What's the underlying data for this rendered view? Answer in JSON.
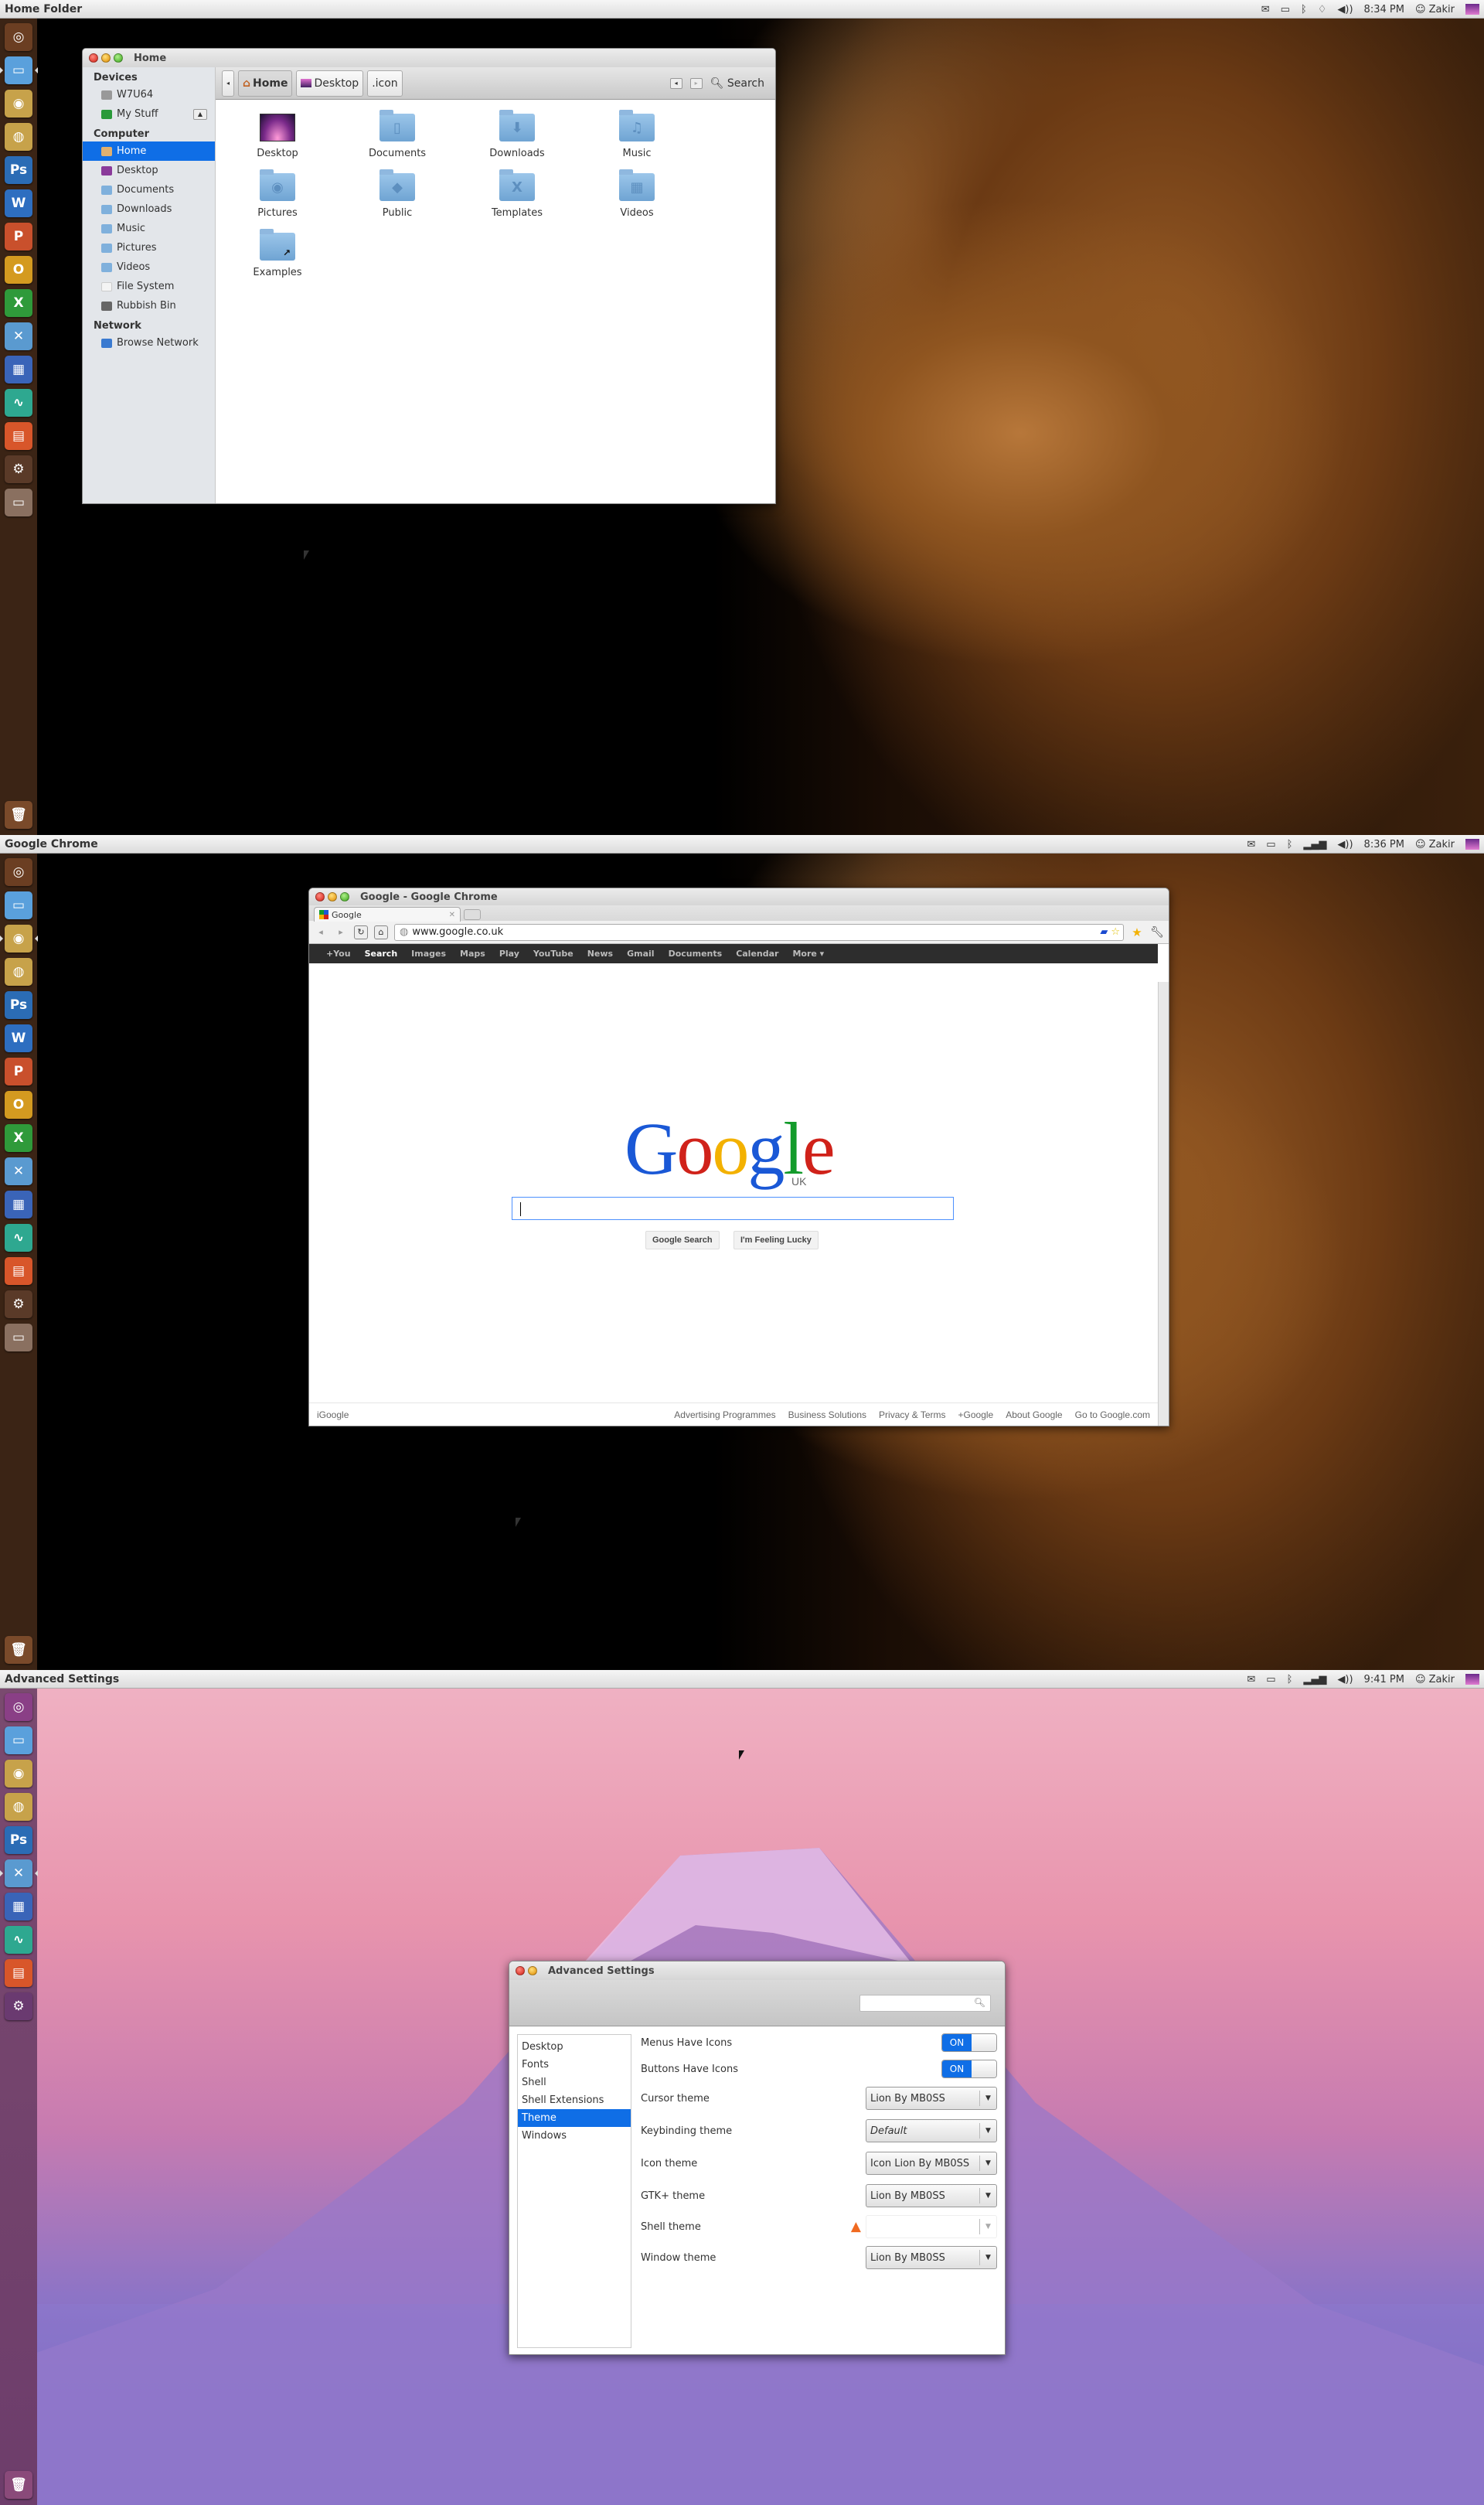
{
  "screens": [
    {
      "topbar": {
        "title": "Home Folder",
        "time": "8:34 PM",
        "user": "Zakir",
        "network_icon": "wifi-icon"
      },
      "launcher": [
        "ubuntu-dash-icon",
        "files-icon",
        "chrome-icon",
        "firefox-icon",
        "photoshop-icon",
        "word-icon",
        "powerpoint-icon",
        "outlook-icon",
        "excel-icon",
        "tools-folder-icon",
        "workspaces-icon",
        "system-monitor-icon",
        "software-center-icon",
        "settings-icon",
        "drive-icon",
        "trash-icon"
      ],
      "window": {
        "title": "Home",
        "sidebar": {
          "sections": [
            {
              "heading": "Devices",
              "items": [
                {
                  "label": "W7U64",
                  "icon": "drive-icon"
                },
                {
                  "label": "My Stuff",
                  "icon": "usb-icon",
                  "eject": true
                }
              ]
            },
            {
              "heading": "Computer",
              "items": [
                {
                  "label": "Home",
                  "icon": "home-icon",
                  "selected": true
                },
                {
                  "label": "Desktop",
                  "icon": "desktop-icon"
                },
                {
                  "label": "Documents",
                  "icon": "folder-icon"
                },
                {
                  "label": "Downloads",
                  "icon": "folder-icon"
                },
                {
                  "label": "Music",
                  "icon": "folder-icon"
                },
                {
                  "label": "Pictures",
                  "icon": "folder-icon"
                },
                {
                  "label": "Videos",
                  "icon": "folder-icon"
                },
                {
                  "label": "File System",
                  "icon": "file-icon"
                },
                {
                  "label": "Rubbish Bin",
                  "icon": "trash-icon"
                }
              ]
            },
            {
              "heading": "Network",
              "items": [
                {
                  "label": "Browse Network",
                  "icon": "network-icon"
                }
              ]
            }
          ]
        },
        "breadcrumbs": [
          "Home",
          "Desktop",
          ".icon"
        ],
        "search_label": "Search",
        "files": [
          {
            "name": "Desktop",
            "glyph": ""
          },
          {
            "name": "Documents",
            "glyph": "▯"
          },
          {
            "name": "Downloads",
            "glyph": "⬇"
          },
          {
            "name": "Music",
            "glyph": "♫"
          },
          {
            "name": "Pictures",
            "glyph": "◉"
          },
          {
            "name": "Public",
            "glyph": "◆"
          },
          {
            "name": "Templates",
            "glyph": "X"
          },
          {
            "name": "Videos",
            "glyph": "▦"
          },
          {
            "name": "Examples",
            "glyph": "↗"
          }
        ]
      }
    },
    {
      "topbar": {
        "title": "Google Chrome",
        "time": "8:36 PM",
        "user": "Zakir",
        "network_icon": "signal-icon"
      },
      "window": {
        "title": "Google - Google Chrome",
        "tab_label": "Google",
        "url": "www.google.co.uk",
        "gbar": [
          "+You",
          "Search",
          "Images",
          "Maps",
          "Play",
          "YouTube",
          "News",
          "Gmail",
          "Documents",
          "Calendar",
          "More ▾"
        ],
        "gbar_selected": "Search",
        "logo_letters": [
          {
            "ch": "G",
            "color": "#1a58d6"
          },
          {
            "ch": "o",
            "color": "#d0221a"
          },
          {
            "ch": "o",
            "color": "#f3b100"
          },
          {
            "ch": "g",
            "color": "#1a58d6"
          },
          {
            "ch": "l",
            "color": "#139b2b"
          },
          {
            "ch": "e",
            "color": "#d0221a"
          }
        ],
        "logo_sub": "UK",
        "search_value": "",
        "buttons": [
          "Google Search",
          "I'm Feeling Lucky"
        ],
        "footer_left": "iGoogle",
        "footer_right": [
          "Advertising Programmes",
          "Business Solutions",
          "Privacy & Terms",
          "+Google",
          "About Google",
          "Go to Google.com"
        ]
      }
    },
    {
      "topbar": {
        "title": "Advanced Settings",
        "time": "9:41 PM",
        "user": "Zakir",
        "network_icon": "signal-icon"
      },
      "window": {
        "title": "Advanced Settings",
        "search_placeholder": "",
        "categories": [
          "Desktop",
          "Fonts",
          "Shell",
          "Shell Extensions",
          "Theme",
          "Windows"
        ],
        "selected_category": "Theme",
        "toggles": [
          {
            "label": "Menus Have Icons",
            "state": "ON"
          },
          {
            "label": "Buttons Have Icons",
            "state": "ON"
          }
        ],
        "combos": [
          {
            "label": "Cursor theme",
            "value": "Lion By MB0SS"
          },
          {
            "label": "Keybinding theme",
            "value": "Default",
            "italic": true
          },
          {
            "label": "Icon theme",
            "value": "Icon Lion By MB0SS"
          },
          {
            "label": "GTK+ theme",
            "value": "Lion By MB0SS"
          },
          {
            "label": "Shell theme",
            "value": "",
            "disabled": true,
            "warning": true
          },
          {
            "label": "Window theme",
            "value": "Lion By MB0SS"
          }
        ]
      }
    }
  ],
  "colors": {
    "selection": "#0f6ee6",
    "launcher_brown": "#3b2415",
    "launcher_purple": "#6d3d6b",
    "warning": "#f06a20"
  }
}
